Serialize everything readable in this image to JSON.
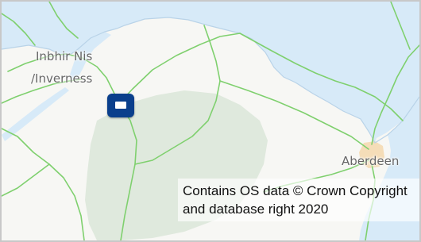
{
  "map": {
    "places": {
      "inbhir_nis": "Inbhir Nis",
      "inverness": "/Inverness",
      "aberdeen": "Aberdeen"
    },
    "attribution": "Contains OS data © Crown Copyright and database right 2020",
    "marker_icon": "location-marker-icon",
    "colors": {
      "sea": "#d7eaf8",
      "land": "#f7f7f4",
      "uplands": "#dfe9dd",
      "roads": "#7fd06e",
      "urban": "#f5ddb8",
      "marker": "#0a3f8c"
    }
  }
}
